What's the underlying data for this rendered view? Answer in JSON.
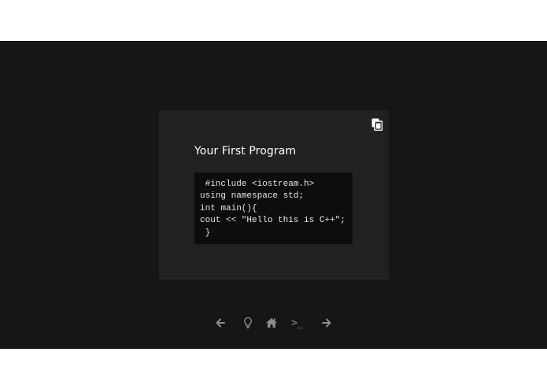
{
  "card": {
    "title": "Your First Program",
    "copy_icon": "copy-icon",
    "code_lines": [
      " #include <iostream.h>",
      "using namespace std;",
      "int main(){",
      "cout << \"Hello this is C++\";",
      " }"
    ]
  },
  "nav": {
    "items": [
      {
        "icon": "arrow-left-icon"
      },
      {
        "icon": "lightbulb-icon"
      },
      {
        "icon": "home-icon"
      },
      {
        "icon": "terminal-icon",
        "glyph": ">_"
      },
      {
        "icon": "arrow-right-icon"
      }
    ]
  },
  "colors": {
    "background": "#161616",
    "card": "#212121",
    "code_bg": "#0d0d0d",
    "nav_icon": "#8c8c8c"
  }
}
